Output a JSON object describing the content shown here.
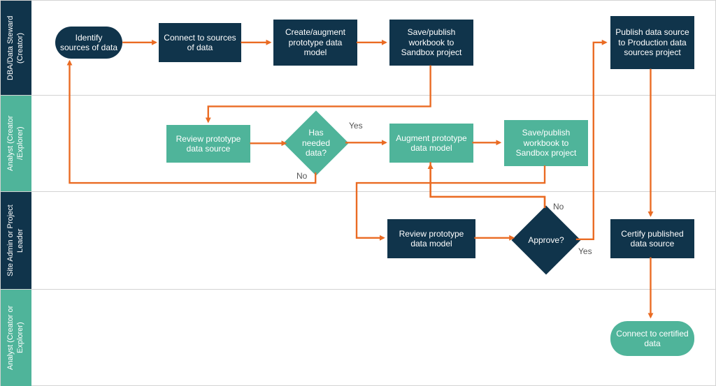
{
  "colors": {
    "navy": "#10344b",
    "teal": "#4fb49a",
    "orange": "#ea6b23"
  },
  "lanes": [
    {
      "id": "lane1",
      "label": "DBA/Data Steward (Creator)",
      "color": "navy"
    },
    {
      "id": "lane2",
      "label": "Analyst (Creator /Explorer)",
      "color": "teal"
    },
    {
      "id": "lane3",
      "label": "Site Admin or Project Leader",
      "color": "navy"
    },
    {
      "id": "lane4",
      "label": "Analyst (Creator or Explorer)",
      "color": "teal"
    }
  ],
  "nodes": {
    "identify": {
      "text": "Identify sources of data"
    },
    "connect": {
      "text": "Connect to sources of data"
    },
    "createModel": {
      "text": "Create/augment prototype data model"
    },
    "savePublish1": {
      "text": "Save/publish workbook to Sandbox project"
    },
    "publishProd": {
      "text": "Publish data source  to Production data sources project"
    },
    "reviewSrc": {
      "text": "Review prototype data source"
    },
    "hasData": {
      "text": "Has needed data?"
    },
    "augment": {
      "text": "Augment prototype data model"
    },
    "savePublish2": {
      "text": "Save/publish workbook to Sandbox project"
    },
    "reviewModel": {
      "text": "Review prototype data model"
    },
    "approve": {
      "text": "Approve?"
    },
    "certify": {
      "text": "Certify published data source"
    },
    "connectCert": {
      "text": "Connect to certified data"
    }
  },
  "annotations": {
    "hasData_yes": "Yes",
    "hasData_no": "No",
    "approve_yes": "Yes",
    "approve_no": "No"
  }
}
